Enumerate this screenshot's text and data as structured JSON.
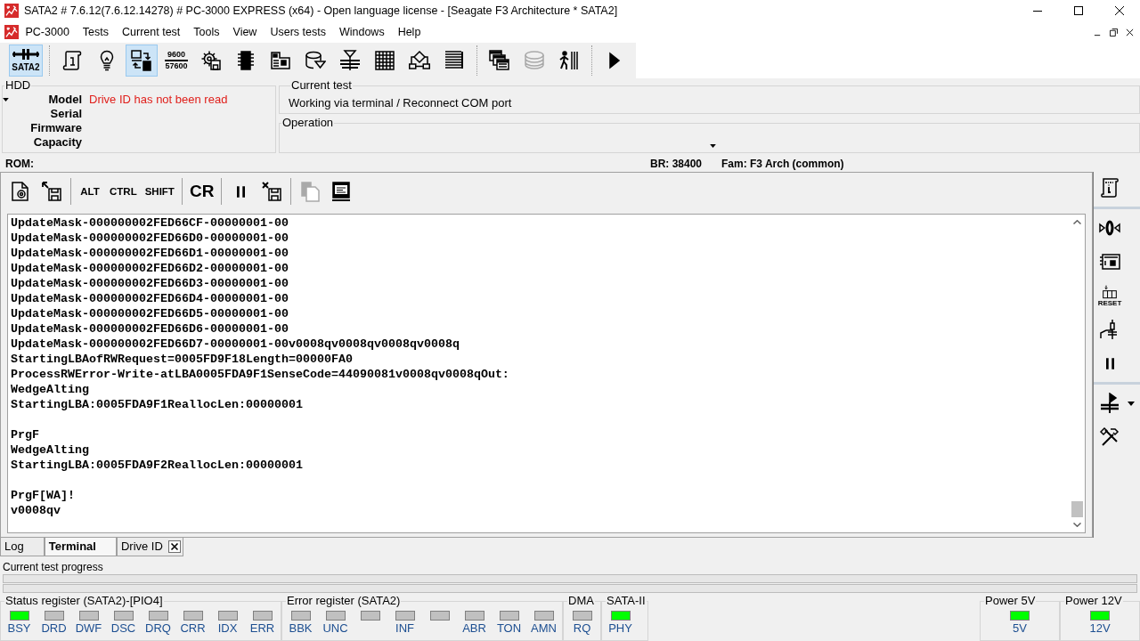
{
  "window": {
    "title": "SATA2 # 7.6.12(7.6.12.14278) # PC-3000 EXPRESS (x64) - Open language license - [Seagate F3 Architecture * SATA2]"
  },
  "menu": [
    "PC-3000",
    "Tests",
    "Current test",
    "Tools",
    "View",
    "Users tests",
    "Windows",
    "Help"
  ],
  "toolbar": [
    {
      "buttons": [
        {
          "kind": "sata",
          "label": "SATA2",
          "selected": true,
          "disabled": false
        }
      ]
    },
    {
      "buttons": [
        {
          "kind": "scroll",
          "selected": false,
          "disabled": false
        },
        {
          "kind": "bulb",
          "selected": false,
          "disabled": false
        },
        {
          "kind": "transfer",
          "selected": true,
          "disabled": false
        },
        {
          "kind": "baud",
          "lines": [
            "9600",
            "57600"
          ],
          "selected": false,
          "disabled": false
        },
        {
          "kind": "gear-disk",
          "selected": false,
          "disabled": false
        },
        {
          "kind": "chip",
          "selected": false,
          "disabled": false
        },
        {
          "kind": "board",
          "selected": false,
          "disabled": false
        },
        {
          "kind": "cylinder",
          "selected": false,
          "disabled": false
        },
        {
          "kind": "head",
          "selected": false,
          "disabled": false
        },
        {
          "kind": "grid",
          "selected": false,
          "disabled": false
        },
        {
          "kind": "flow",
          "selected": false,
          "disabled": false
        },
        {
          "kind": "lines",
          "selected": false,
          "disabled": false
        }
      ]
    },
    {
      "buttons": [
        {
          "kind": "windows",
          "selected": false,
          "disabled": false
        },
        {
          "kind": "platters",
          "selected": false,
          "disabled": true
        },
        {
          "kind": "walk",
          "selected": false,
          "disabled": false
        }
      ]
    },
    {
      "buttons": [
        {
          "kind": "play",
          "selected": false,
          "disabled": false
        }
      ]
    }
  ],
  "hdd": {
    "title": "HDD",
    "fields": [
      {
        "label": "Model",
        "value": "Drive ID has not been read"
      },
      {
        "label": "Serial"
      },
      {
        "label": "Firmware"
      },
      {
        "label": "Capacity"
      }
    ]
  },
  "current_test": {
    "title": "Current test",
    "value": "Working via terminal / Reconnect COM port"
  },
  "operation": {
    "title": "Operation"
  },
  "info_bar": {
    "rom": "ROM:",
    "baud": "BR: 38400",
    "family": "Fam: F3 Arch (common)"
  },
  "terminal": {
    "toolbar": [
      {
        "buttons": [
          {
            "kind": "file-gear",
            "disabled": false
          },
          {
            "kind": "floppy-arrow",
            "disabled": false
          }
        ]
      },
      {
        "buttons": [
          {
            "kind": "text",
            "label": "ALT",
            "disabled": false
          },
          {
            "kind": "text",
            "label": "CTRL",
            "disabled": false
          },
          {
            "kind": "text",
            "label": "SHIFT",
            "disabled": false
          }
        ]
      },
      {
        "buttons": [
          {
            "kind": "big-text",
            "label": "CR",
            "disabled": false
          }
        ]
      },
      {
        "buttons": [
          {
            "kind": "pause",
            "disabled": false
          },
          {
            "kind": "floppy-cross",
            "disabled": false
          }
        ]
      },
      {
        "buttons": [
          {
            "kind": "copy",
            "disabled": true
          },
          {
            "kind": "terminal",
            "disabled": false
          }
        ]
      }
    ],
    "blocks": [
      [
        "UpdateMask-000000002FED66CF-00000001-00",
        "UpdateMask-000000002FED66D0-00000001-00",
        "UpdateMask-000000002FED66D1-00000001-00",
        "UpdateMask-000000002FED66D2-00000001-00",
        "UpdateMask-000000002FED66D3-00000001-00",
        "UpdateMask-000000002FED66D4-00000001-00",
        "UpdateMask-000000002FED66D5-00000001-00",
        "UpdateMask-000000002FED66D6-00000001-00",
        "UpdateMask-000000002FED66D7-00000001-00v0008qv0008qv0008qv0008q",
        "StartingLBAofRWRequest=0005FD9F18Length=00000FA0",
        "ProcessRWError-Write-atLBA0005FDA9F1SenseCode=44090081v0008qv0008qOut:",
        "WedgeAlting",
        "StartingLBA:0005FDA9F1ReallocLen:00000001"
      ],
      [
        "PrgF",
        "WedgeAlting",
        "StartingLBA:0005FDA9F2ReallocLen:00000001"
      ],
      [
        "PrgF[WA]!",
        "v0008qv"
      ]
    ]
  },
  "side_toolbar": [
    {
      "buttons": [
        {
          "kind": "scroll-info"
        }
      ]
    },
    {
      "buttons": [
        {
          "kind": "zero"
        },
        {
          "kind": "board2"
        },
        {
          "kind": "reset",
          "label": "RESET"
        },
        {
          "kind": "circuit"
        },
        {
          "kind": "pause"
        }
      ]
    },
    {
      "buttons": [
        {
          "kind": "play-stack"
        },
        {
          "kind": "tools"
        }
      ]
    }
  ],
  "tabs": [
    {
      "label": "Log",
      "selected": false,
      "closable": false
    },
    {
      "label": "Terminal",
      "selected": true,
      "closable": false
    },
    {
      "label": "Drive ID",
      "selected": false,
      "closable": true
    }
  ],
  "progress": {
    "label": "Current test progress",
    "bars": [
      {
        "level": 0
      },
      {
        "level": 0
      }
    ]
  },
  "registers": [
    {
      "title": "Status register (SATA2)-[PIO4]",
      "leds": [
        {
          "label": "BSY",
          "on": true
        },
        {
          "label": "DRD",
          "on": false
        },
        {
          "label": "DWF",
          "on": false
        },
        {
          "label": "DSC",
          "on": false
        },
        {
          "label": "DRQ",
          "on": false
        },
        {
          "label": "CRR",
          "on": false
        },
        {
          "label": "IDX",
          "on": false
        },
        {
          "label": "ERR",
          "on": false
        }
      ]
    },
    {
      "title": "Error register (SATA2)",
      "leds": [
        {
          "label": "BBK",
          "on": false
        },
        {
          "label": "UNC",
          "on": false
        },
        {
          "on": false
        },
        {
          "label": "INF",
          "on": false
        },
        {
          "on": false
        },
        {
          "label": "ABR",
          "on": false
        },
        {
          "label": "TON",
          "on": false
        },
        {
          "label": "AMN",
          "on": false
        }
      ]
    },
    {
      "title": "DMA",
      "leds": [
        {
          "label": "RQ",
          "on": false
        }
      ]
    },
    {
      "title": "SATA-II",
      "leds": [
        {
          "label": "PHY",
          "on": true
        }
      ]
    }
  ],
  "power": [
    {
      "title": "Power 5V",
      "leds": [
        {
          "label": "5V",
          "on": true
        }
      ]
    },
    {
      "title": "Power 12V",
      "leds": [
        {
          "label": "12V",
          "on": true
        }
      ]
    }
  ]
}
